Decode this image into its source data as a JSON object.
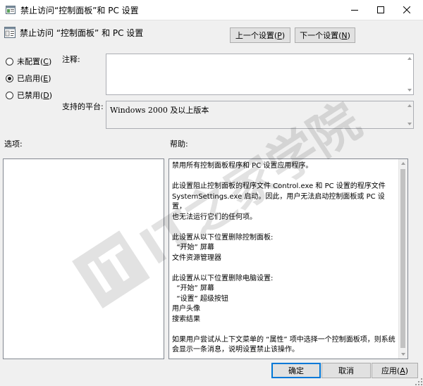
{
  "window": {
    "title": "禁止访问“控制面板”和 PC 设置",
    "controls": {
      "minimize": "minimize-icon",
      "maximize": "maximize-icon",
      "close": "close-icon"
    }
  },
  "header": {
    "title": "禁止访问 “控制面板” 和 PC 设置",
    "prev_button": {
      "label": "上一个设置(",
      "key": "P",
      "suffix": ")"
    },
    "next_button": {
      "label": "下一个设置(",
      "key": "N",
      "suffix": ")"
    }
  },
  "state_options": [
    {
      "label": "未配置(",
      "key": "C",
      "suffix": ")",
      "checked": false
    },
    {
      "label": "已启用(",
      "key": "E",
      "suffix": ")",
      "checked": true
    },
    {
      "label": "已禁用(",
      "key": "D",
      "suffix": ")",
      "checked": false
    }
  ],
  "comment": {
    "label": "注释:",
    "value": ""
  },
  "supported": {
    "label": "支持的平台:",
    "value": "Windows 2000 及以上版本"
  },
  "options": {
    "label": "选项:"
  },
  "help": {
    "label": "帮助:",
    "lines": [
      {
        "text": "禁用所有控制面板程序和 PC 设置应用程序。",
        "gap": false
      },
      {
        "text": "此设置阻止控制面板的程序文件 Control.exe 和 PC 设置的程序文件",
        "gap": true
      },
      {
        "text": "SystemSettings.exe 启动。因此，用户无法启动控制面板或 PC 设置，",
        "gap": false
      },
      {
        "text": "也无法运行它们的任何项。",
        "gap": false
      },
      {
        "text": "此设置从以下位置删除控制面板:",
        "gap": true
      },
      {
        "text": "  “开始” 屏幕",
        "gap": false
      },
      {
        "text": "文件资源管理器",
        "gap": false
      },
      {
        "text": "此设置从以下位置删除电脑设置:",
        "gap": true
      },
      {
        "text": "  “开始” 屏幕",
        "gap": false
      },
      {
        "text": "  “设置” 超级按钮",
        "gap": false
      },
      {
        "text": "用户头像",
        "gap": false
      },
      {
        "text": "搜索结果",
        "gap": false
      },
      {
        "text": "如果用户尝试从上下文菜单的 “属性” 项中选择一个控制面板项，则系统",
        "gap": true
      },
      {
        "text": "会显示一条消息，说明设置禁止该操作。",
        "gap": false
      }
    ]
  },
  "footer": {
    "ok": "确定",
    "cancel": "取消",
    "apply": {
      "label": "应用(",
      "key": "A",
      "suffix": ")"
    }
  },
  "watermark": "IT之家学院",
  "colors": {
    "accent": "#0078d7",
    "background": "#f0f0f0"
  }
}
